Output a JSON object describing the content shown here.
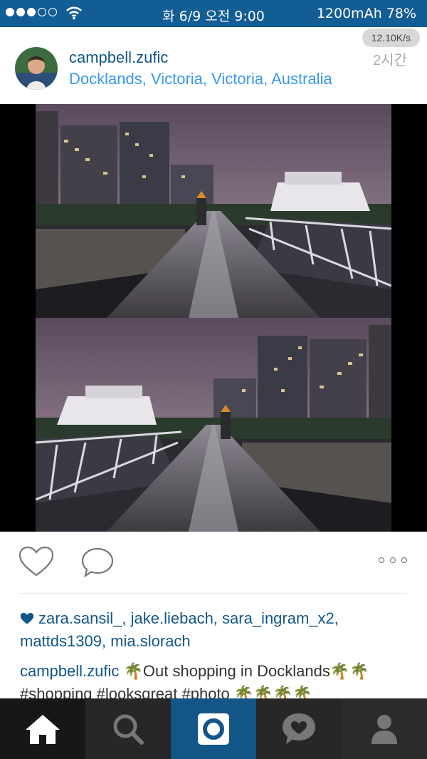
{
  "status_bar": {
    "signal_dots_filled": 3,
    "signal_dots_total": 5,
    "datetime": "화 6/9 오전 9:00",
    "battery": "1200mAh 78%"
  },
  "post": {
    "username": "campbell.zufic",
    "location": "Docklands, Victoria, Victoria, Australia",
    "net_speed": "12.10K/s",
    "age": "2시간",
    "likers_line": "zara.sansil_, jake.liebach, sara_ingram_x2, mattds1309, mia.slorach",
    "caption_user": "campbell.zufic",
    "caption_text": "🌴Out shopping in Docklands🌴🌴 #shopping #looksgreat #photo 🌴🌴🌴🌴"
  },
  "icons": {
    "like": "heart-outline-icon",
    "comment": "comment-bubble-icon",
    "more": "more-dots-icon",
    "tabs": [
      "home-icon",
      "search-icon",
      "camera-icon",
      "activity-heart-icon",
      "profile-icon"
    ]
  },
  "colors": {
    "status_bar": "#135d95",
    "link_blue": "#125688",
    "location_blue": "#3897f0",
    "tab_bar": "#272727",
    "tab_active": "#125688"
  }
}
